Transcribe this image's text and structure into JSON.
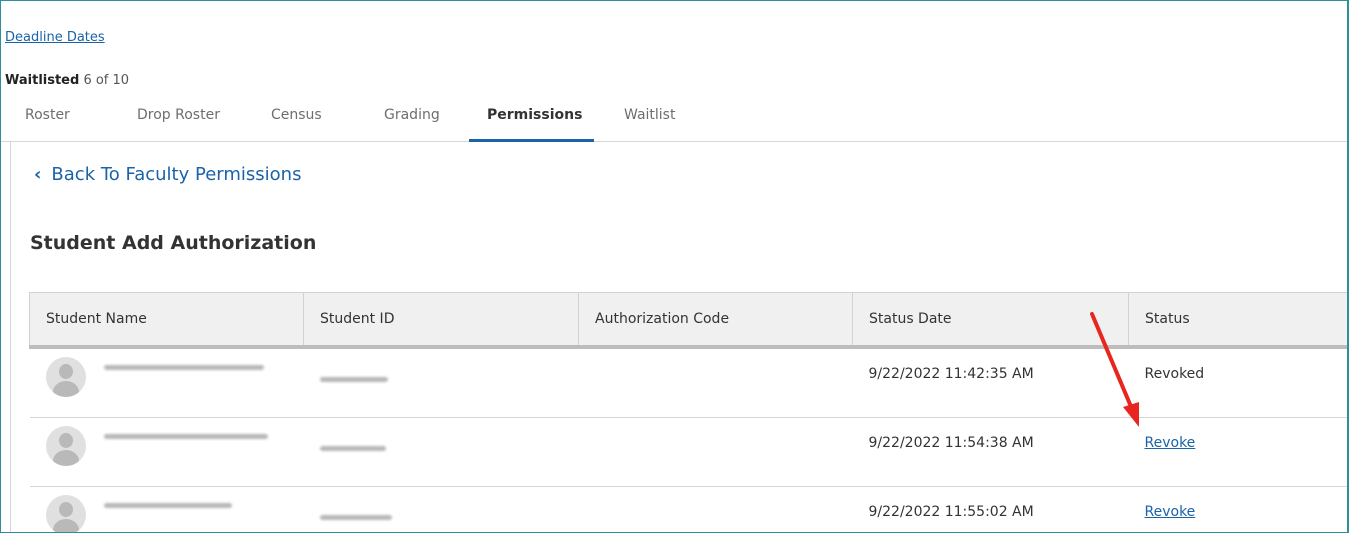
{
  "header": {
    "deadline_link": "Deadline Dates",
    "waitlisted_label": "Waitlisted",
    "waitlisted_count": "6 of 10"
  },
  "tabs": [
    {
      "label": "Roster",
      "active": false
    },
    {
      "label": "Drop Roster",
      "active": false
    },
    {
      "label": "Census",
      "active": false
    },
    {
      "label": "Grading",
      "active": false
    },
    {
      "label": "Permissions",
      "active": true
    },
    {
      "label": "Waitlist",
      "active": false
    }
  ],
  "back_link": {
    "icon": "chevron-left-icon",
    "label": "Back To Faculty Permissions"
  },
  "section_title": "Student Add Authorization",
  "table": {
    "columns": [
      "Student Name",
      "Student ID",
      "Authorization Code",
      "Status Date",
      "Status"
    ],
    "rows": [
      {
        "status_date": "9/22/2022 11:42:35 AM",
        "status": "Revoked",
        "status_is_link": false
      },
      {
        "status_date": "9/22/2022 11:54:38 AM",
        "status": "Revoke",
        "status_is_link": true
      },
      {
        "status_date": "9/22/2022 11:55:02 AM",
        "status": "Revoke",
        "status_is_link": true
      }
    ]
  },
  "colors": {
    "link": "#1a63a8",
    "frame_border": "#2e8f9b",
    "annotation_arrow": "#e8261f",
    "header_bg": "#f0f0f0"
  }
}
